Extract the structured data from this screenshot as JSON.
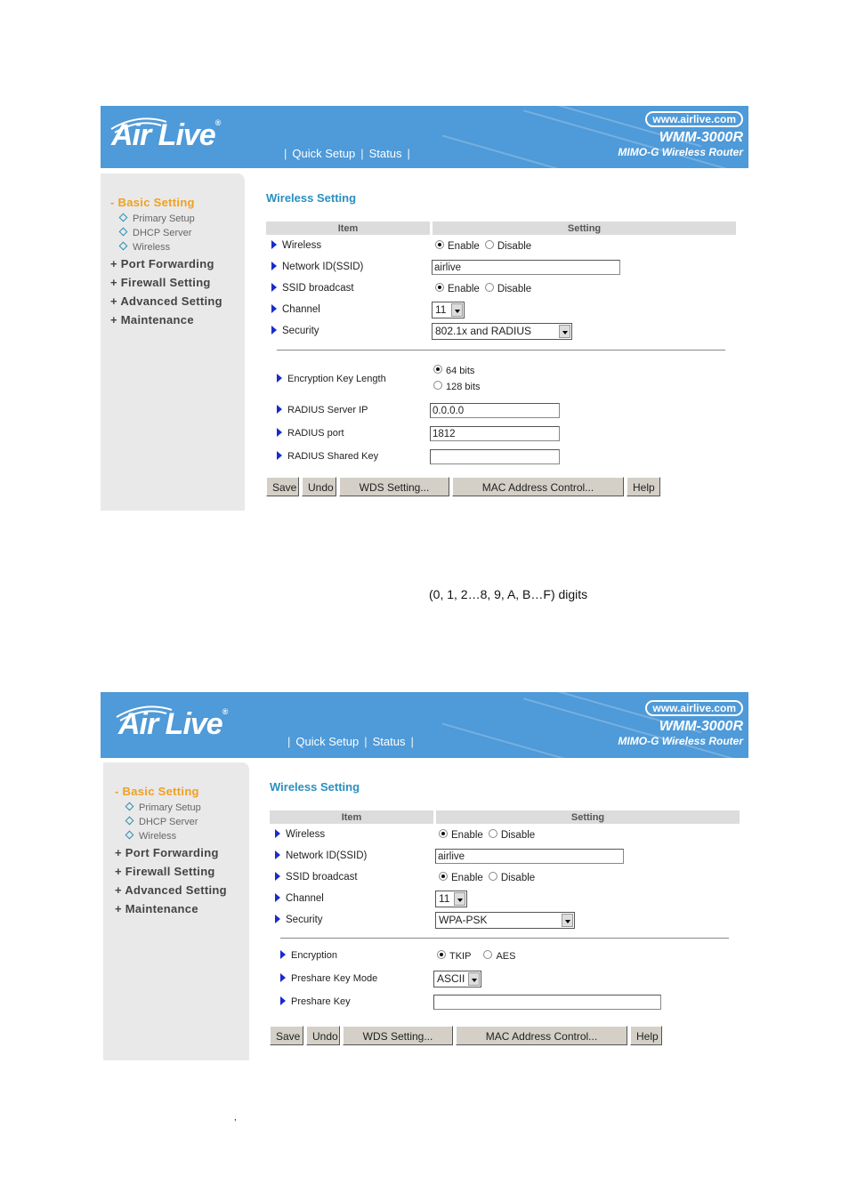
{
  "header": {
    "logo": "Air Live",
    "nav": [
      "Quick Setup",
      "Status"
    ],
    "url": "www.airlive.com",
    "model": "WMM-3000R",
    "subtitle": "MIMO-G Wireless Router"
  },
  "sidebar": {
    "active_group": "- Basic Setting",
    "sub_items": [
      "Primary Setup",
      "DHCP Server",
      "Wireless"
    ],
    "groups": [
      "+ Port Forwarding",
      "+ Firewall Setting",
      "+ Advanced Setting",
      "+ Maintenance"
    ]
  },
  "panel1": {
    "title": "Wireless Setting",
    "headers": {
      "item": "Item",
      "setting": "Setting"
    },
    "rows": {
      "wireless": {
        "label": "Wireless",
        "opt1": "Enable",
        "opt2": "Disable",
        "selected": "Enable"
      },
      "ssid": {
        "label": "Network ID(SSID)",
        "value": "airlive"
      },
      "broadcast": {
        "label": "SSID broadcast",
        "opt1": "Enable",
        "opt2": "Disable",
        "selected": "Enable"
      },
      "channel": {
        "label": "Channel",
        "value": "11"
      },
      "security": {
        "label": "Security",
        "value": "802.1x and RADIUS"
      }
    },
    "extra": {
      "keylen": {
        "label": "Encryption Key Length",
        "opt1": "64 bits",
        "opt2": "128 bits",
        "selected": "64 bits"
      },
      "server_ip": {
        "label": "RADIUS Server IP",
        "value": "0.0.0.0"
      },
      "port": {
        "label": "RADIUS port",
        "value": "1812"
      },
      "shared_key": {
        "label": "RADIUS Shared Key",
        "value": ""
      }
    },
    "buttons": {
      "save": "Save",
      "undo": "Undo",
      "wds": "WDS Setting...",
      "mac": "MAC Address Control...",
      "help": "Help"
    }
  },
  "caption": "(0, 1, 2…8, 9, A, B…F) digits",
  "panel2": {
    "title": "Wireless Setting",
    "headers": {
      "item": "Item",
      "setting": "Setting"
    },
    "rows": {
      "wireless": {
        "label": "Wireless",
        "opt1": "Enable",
        "opt2": "Disable",
        "selected": "Enable"
      },
      "ssid": {
        "label": "Network ID(SSID)",
        "value": "airlive"
      },
      "broadcast": {
        "label": "SSID broadcast",
        "opt1": "Enable",
        "opt2": "Disable",
        "selected": "Enable"
      },
      "channel": {
        "label": "Channel",
        "value": "11"
      },
      "security": {
        "label": "Security",
        "value": "WPA-PSK"
      }
    },
    "extra": {
      "encryption": {
        "label": "Encryption",
        "opt1": "TKIP",
        "opt2": "AES",
        "selected": "TKIP"
      },
      "psk_mode": {
        "label": "Preshare Key Mode",
        "value": "ASCII"
      },
      "psk": {
        "label": "Preshare Key",
        "value": ""
      }
    },
    "buttons": {
      "save": "Save",
      "undo": "Undo",
      "wds": "WDS Setting...",
      "mac": "MAC Address Control...",
      "help": "Help"
    }
  },
  "stray_mark": ","
}
